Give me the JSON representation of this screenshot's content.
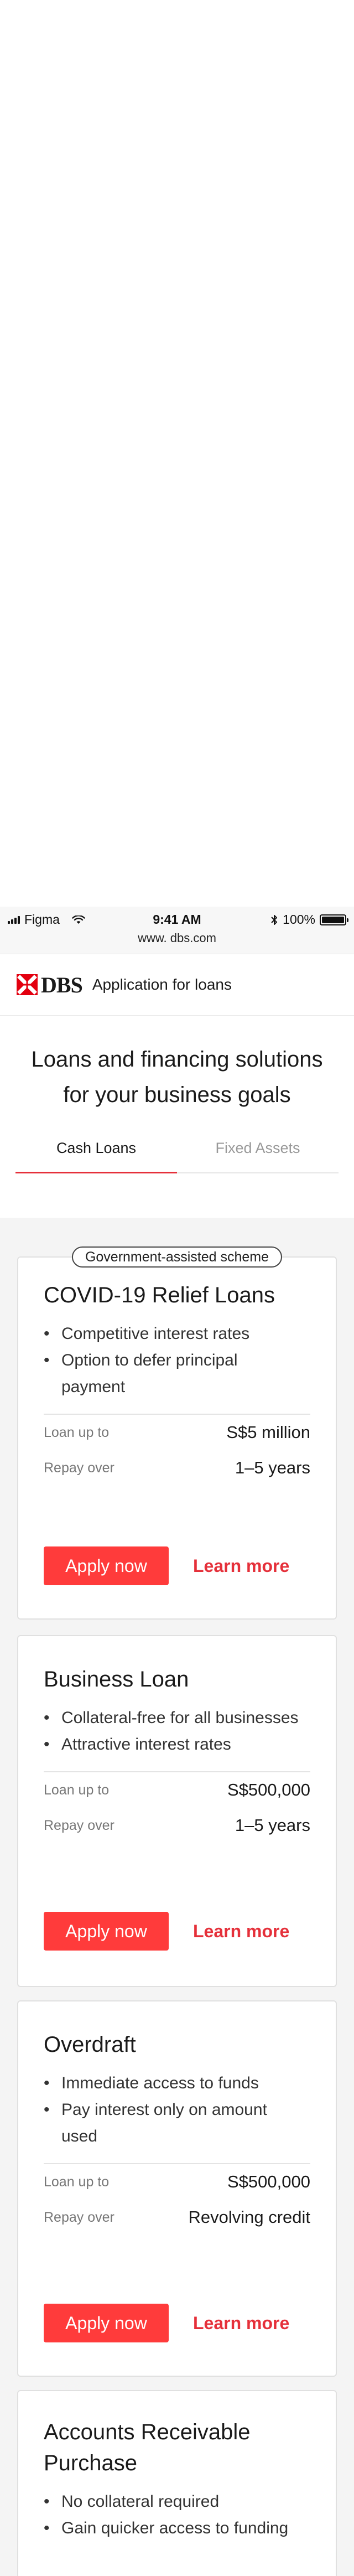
{
  "statusbar": {
    "carrier": "Figma",
    "time": "9:41 AM",
    "battery": "100%"
  },
  "browser": {
    "url": "www. dbs.com"
  },
  "header": {
    "brand": "DBS",
    "title": "Application for loans"
  },
  "hero": {
    "line1": "Loans and financing solutions",
    "line2": "for your business goals"
  },
  "tabs": [
    {
      "label": "Cash Loans"
    },
    {
      "label": "Fixed Assets"
    }
  ],
  "cards": [
    {
      "badge": "Government-assisted scheme",
      "title": "COVID-19 Relief Loans",
      "bullets": [
        "Competitive interest rates",
        "Option to defer principal",
        "payment"
      ],
      "loan_label": "Loan up to",
      "loan_value": "S$5 million",
      "repay_label": "Repay over",
      "repay_value": "1–5 years",
      "apply": "Apply now",
      "learn": "Learn more"
    },
    {
      "title": "Business Loan",
      "bullets": [
        "Collateral-free for all businesses",
        "Attractive interest rates"
      ],
      "loan_label": "Loan up to",
      "loan_value": "S$500,000",
      "repay_label": "Repay over",
      "repay_value": "1–5 years",
      "apply": "Apply now",
      "learn": "Learn more"
    },
    {
      "title": "Overdraft",
      "bullets": [
        "Immediate access to funds",
        "Pay interest only on amount",
        "used"
      ],
      "loan_label": "Loan up to",
      "loan_value": "S$500,000",
      "repay_label": "Repay over",
      "repay_value": "Revolving credit",
      "apply": "Apply now",
      "learn": "Learn more"
    },
    {
      "title_line1": "Accounts Receivable",
      "title_line2": "Purchase",
      "bullets": [
        "No collateral required",
        "Gain quicker access to funding"
      ]
    }
  ]
}
